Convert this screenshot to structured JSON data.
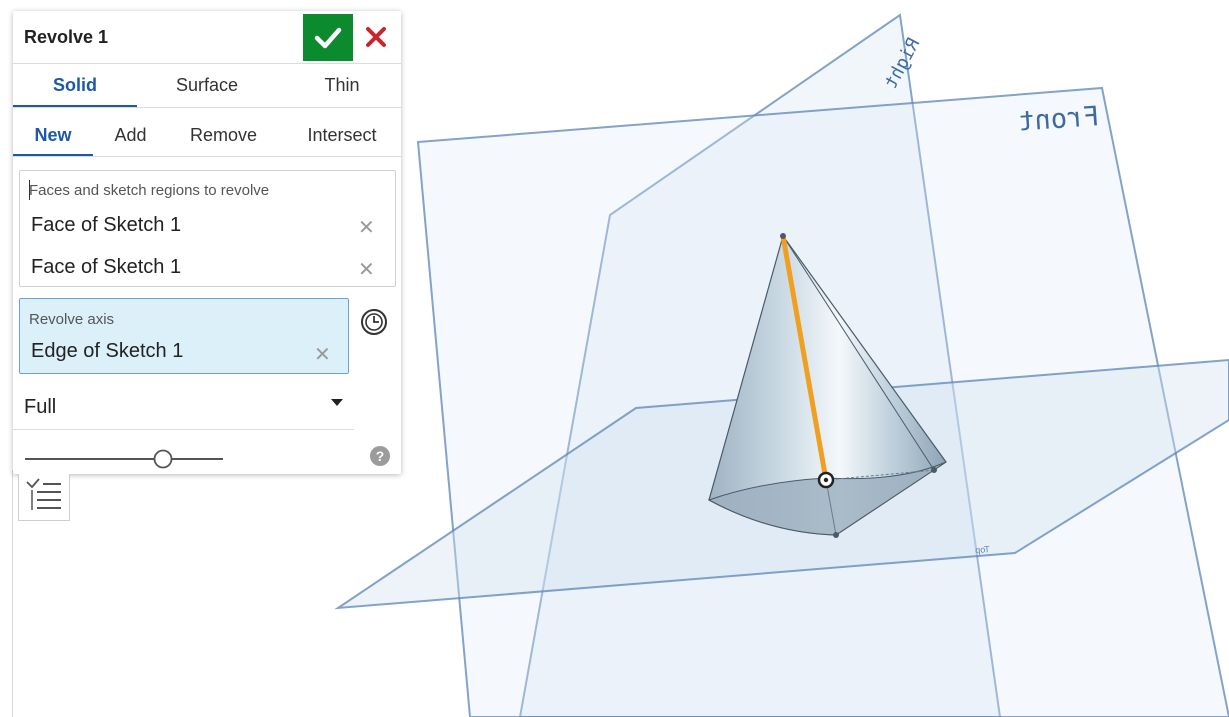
{
  "panel": {
    "title": "Revolve 1",
    "ok_icon": "checkmark-icon",
    "cancel_icon": "close-icon",
    "type_tabs": [
      {
        "label": "Solid",
        "active": true
      },
      {
        "label": "Surface",
        "active": false
      },
      {
        "label": "Thin",
        "active": false
      }
    ],
    "operation_tabs": [
      {
        "label": "New",
        "active": true
      },
      {
        "label": "Add",
        "active": false
      },
      {
        "label": "Remove",
        "active": false
      },
      {
        "label": "Intersect",
        "active": false
      }
    ],
    "faces_field": {
      "label": "Faces and sketch regions to revolve",
      "items": [
        "Face of Sketch 1",
        "Face of Sketch 1"
      ]
    },
    "axis_field": {
      "label": "Revolve axis",
      "value": "Edge of Sketch 1"
    },
    "revolve_type": "Full",
    "help_icon": "help-icon",
    "feature_list_icon": "list-icon"
  },
  "viewport": {
    "planes": [
      "Front",
      "Right",
      "Top"
    ],
    "accent_color": "#f0a020",
    "plane_color": "#5b86b8",
    "background": "#ffffff"
  }
}
